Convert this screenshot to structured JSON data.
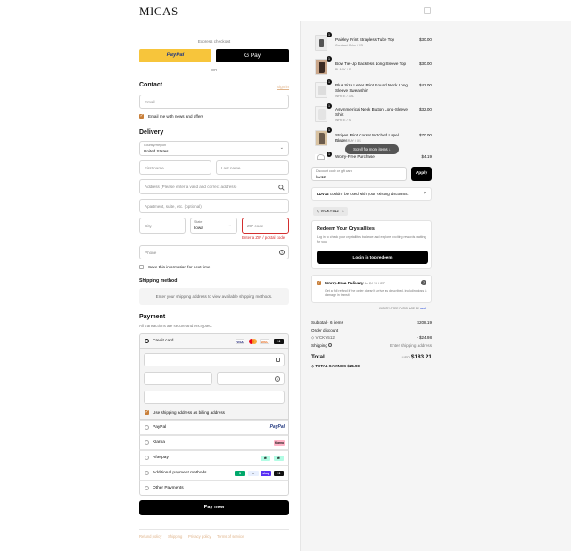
{
  "header": {
    "logo": "MICAS"
  },
  "express": {
    "title": "Express checkout",
    "paypal": "PayPal",
    "gpay": "G Pay",
    "or": "OR"
  },
  "contact": {
    "title": "Contact",
    "signin": "Sign in",
    "email_placeholder": "Email",
    "news_label": "Email me with news and offers"
  },
  "delivery": {
    "title": "Delivery",
    "country_label": "Country/Region",
    "country_value": "United States",
    "first_name": "First name",
    "last_name": "Last name",
    "address": "Address (Please enter a valid and correct address)",
    "apartment": "Apartment, suite, etc. (optional)",
    "city": "City",
    "state_label": "State",
    "state_value": "Iowa",
    "zip": "ZIP code",
    "zip_error": "Enter a ZIP / postal code",
    "phone": "Phone",
    "save_label": "Save this information for next time"
  },
  "shipping": {
    "title": "Shipping method",
    "note": "Enter your shipping address to view available shipping methods."
  },
  "payment": {
    "title": "Payment",
    "subtitle": "All transactions are secure and encrypted.",
    "credit_card": "Credit card",
    "billing_label": "Use shipping address as billing address",
    "paypal": "PayPal",
    "klarna": "Klarna",
    "afterpay": "Afterpay",
    "additional": "Additional payment methods",
    "other": "Other Payments",
    "card_more": "+6",
    "additional_more": "+3"
  },
  "pay_now": "Pay now",
  "footer_links": [
    "Refund policy",
    "Shipping",
    "Privacy policy",
    "Terms of service"
  ],
  "items": [
    {
      "name": "Paisley Print Strapless Tube Top",
      "variant": "Contrast Color / XS",
      "price": "$30.00",
      "qty": "1"
    },
    {
      "name": "Bow Tie-Up Backless Long-Sleeve Top",
      "variant": "BLACK / S",
      "price": "$30.00",
      "qty": "1"
    },
    {
      "name": "Plus Size Letter Print Round Neck Long Sleeve Sweatshirt",
      "variant": "WHITE / 3XL",
      "price": "$42.00",
      "qty": "1"
    },
    {
      "name": "Asymmetrical Neck Button Long-Sleeve Shirt",
      "variant": "WHITE / S",
      "price": "$32.00",
      "qty": "1"
    },
    {
      "name": "Stripes Print Corset Notched Lapel Blazer",
      "variant": "DARK GRAY / XS",
      "price": "$70.00",
      "qty": "1"
    },
    {
      "name": "Worry-Free Purchase",
      "variant": "",
      "price": "$4.19",
      "qty": "1"
    }
  ],
  "scroll_hint": "Scroll for more items",
  "discount": {
    "label": "Discount code or gift card",
    "value": "luv12",
    "apply": "Apply",
    "error": "couldn't be used with your existing discounts.",
    "error_code": "LUV12",
    "applied_code": "VICKY512"
  },
  "crystallites": {
    "title": "Redeem Your Crystallites",
    "text": "Log in to check your crystallites balance and explore exciting rewards waiting for you.",
    "button": "Login in top redeem"
  },
  "worry": {
    "title": "Worry-Free Delivery",
    "price_note": "for $4.19 USD",
    "text": "Get a full refund if the order doesn't arrive as described, including loss & damage in transit",
    "powered": "WORRY-FREE PURCHASE BY",
    "brand": "seel"
  },
  "summary": {
    "subtotal_label": "Subtotal · 6 items",
    "subtotal": "$208.19",
    "order_discount": "Order discount",
    "code": "VICKY512",
    "discount": "- $24.98",
    "shipping_label": "Shipping",
    "shipping_value": "Enter shipping address",
    "total_label": "Total",
    "currency": "USD",
    "total": "$183.21",
    "savings_label": "TOTAL SAVINGS",
    "savings": "$24.98"
  },
  "colors": {
    "accent": "#c87f3a",
    "error": "#d32f2f",
    "paypal_yellow": "#f7c53b",
    "dark": "#111111"
  }
}
